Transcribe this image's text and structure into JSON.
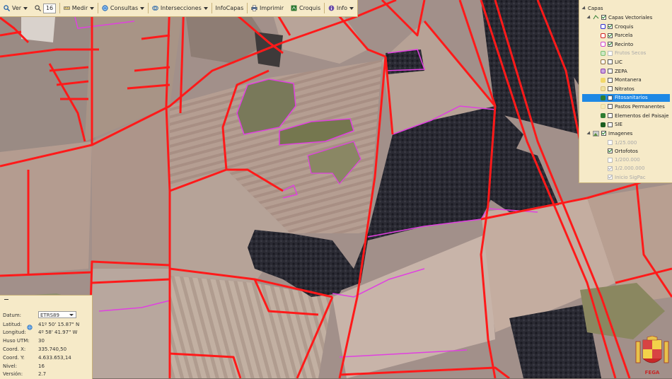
{
  "toolbar": {
    "ver_label": "Ver",
    "zoom_value": "16",
    "medir_label": "Medir",
    "consultas_label": "Consultas",
    "intersecciones_label": "Intersecciones",
    "infocapas_label": "InfoCapas",
    "imprimir_label": "Imprimir",
    "croquis_label": "Croquis",
    "info_label": "Info"
  },
  "layers": {
    "root": "Capas",
    "group_vector": "Capas Vectoriales",
    "items": [
      {
        "label": "Croquis",
        "checked": true,
        "enabled": true
      },
      {
        "label": "Parcela",
        "checked": true,
        "enabled": true
      },
      {
        "label": "Recinto",
        "checked": true,
        "enabled": true
      },
      {
        "label": "Frutos Secos",
        "checked": false,
        "enabled": false
      },
      {
        "label": "LIC",
        "checked": false,
        "enabled": true
      },
      {
        "label": "ZEPA",
        "checked": false,
        "enabled": true
      },
      {
        "label": "Montanera",
        "checked": false,
        "enabled": true
      },
      {
        "label": "Nitratos",
        "checked": false,
        "enabled": true
      },
      {
        "label": "Fitosanitarios",
        "checked": false,
        "enabled": true,
        "selected": true
      },
      {
        "label": "Pastos Permanentes",
        "checked": false,
        "enabled": true
      },
      {
        "label": "Elementos del Paisaje",
        "checked": false,
        "enabled": true
      },
      {
        "label": "SIE",
        "checked": false,
        "enabled": true
      }
    ],
    "group_images": "Imagenes",
    "image_items": [
      {
        "label": "1/25.000",
        "checked": false,
        "enabled": false
      },
      {
        "label": "Ortofotos",
        "checked": true,
        "enabled": true
      },
      {
        "label": "1/200.000",
        "checked": false,
        "enabled": false
      },
      {
        "label": "1/2.000.000",
        "checked": true,
        "enabled": false
      },
      {
        "label": "Inicio SigPac",
        "checked": true,
        "enabled": false
      }
    ]
  },
  "info": {
    "datum_label": "Datum:",
    "datum_value": "ETRS89",
    "latitud_label": "Latitud:",
    "latitud_value": "41º 50' 15.87\" N",
    "longitud_label": "Longitud:",
    "longitud_value": "4º 58' 41.97\" W",
    "huso_label": "Huso UTM:",
    "huso_value": "30",
    "coordx_label": "Coord. X:",
    "coordx_value": "335.740,50",
    "coordy_label": "Coord. Y:",
    "coordy_value": "4.633.653,14",
    "nivel_label": "Nivel:",
    "nivel_value": "16",
    "version_label": "Versión:",
    "version_value": "2.7"
  },
  "logo": {
    "text": "FEGA"
  },
  "colors": {
    "parcel_border": "#ff1a1a",
    "recinto_border": "#e040e0",
    "panel_bg": "#f6eac8",
    "selected": "#1e88e5"
  }
}
